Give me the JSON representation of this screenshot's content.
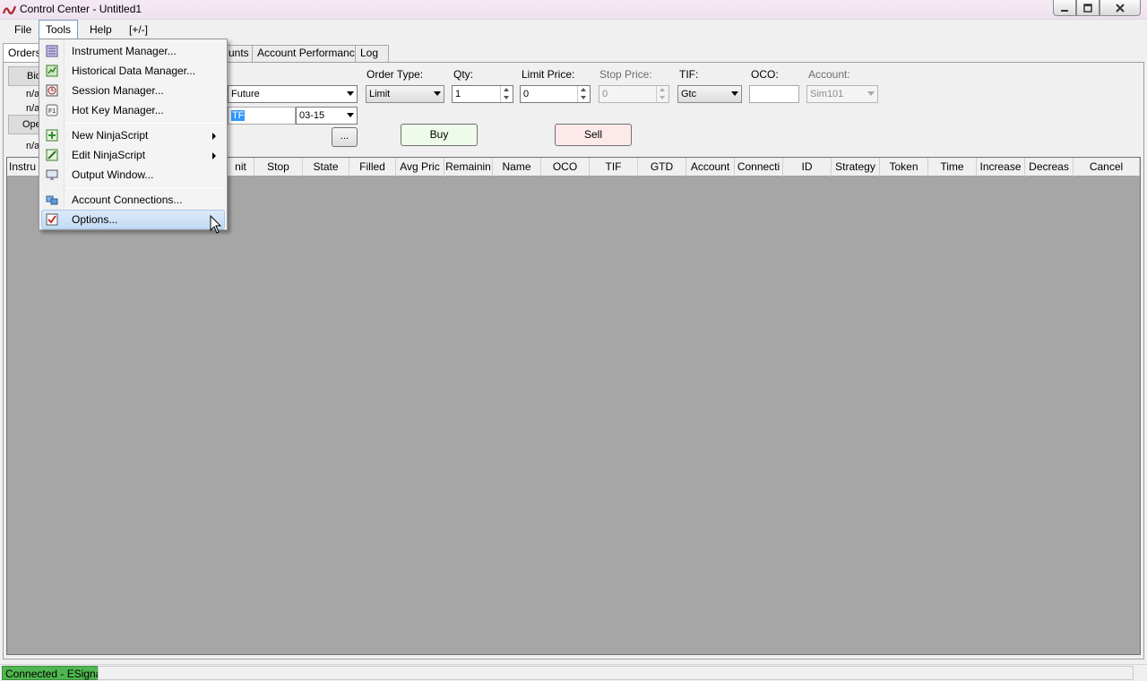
{
  "window": {
    "title": "Control Center - Untitled1",
    "app_icon": "ninjatrader-logo-icon"
  },
  "menubar": {
    "items": [
      {
        "label": "File"
      },
      {
        "label": "Tools"
      },
      {
        "label": "Help"
      },
      {
        "label": "[+/-]"
      }
    ]
  },
  "tabs": [
    {
      "label": "Orders"
    },
    {
      "label": "unts"
    },
    {
      "label": "Account Performance"
    },
    {
      "label": "Log"
    }
  ],
  "left_grid": {
    "rows": [
      {
        "label": "Bid"
      },
      {
        "label": "n/a"
      },
      {
        "label": "n/a"
      },
      {
        "label": "Ope"
      },
      {
        "label": "n/a"
      }
    ]
  },
  "order_entry": {
    "instrument_type": "Future",
    "instrument_name_selected": "TF",
    "expiry": "03-15",
    "browse_label": "...",
    "order_type_label": "Order Type:",
    "order_type_value": "Limit",
    "qty_label": "Qty:",
    "qty_value": "1",
    "limit_price_label": "Limit Price:",
    "limit_price_value": "0",
    "stop_price_label": "Stop Price:",
    "stop_price_value": "0",
    "tif_label": "TIF:",
    "tif_value": "Gtc",
    "oco_label": "OCO:",
    "oco_value": "",
    "account_label": "Account:",
    "account_value": "Sim101",
    "buy_label": "Buy",
    "sell_label": "Sell"
  },
  "orders_grid": {
    "columns": [
      "Instru",
      "nit",
      "Stop",
      "State",
      "Filled",
      "Avg Pric",
      "Remainin",
      "Name",
      "OCO",
      "TIF",
      "GTD",
      "Account",
      "Connecti",
      "ID",
      "Strategy",
      "Token",
      "Time",
      "Increase",
      "Decreas",
      "Cancel"
    ]
  },
  "tools_menu": {
    "items": [
      {
        "label": "Instrument Manager...",
        "icon": "instrument-manager-icon"
      },
      {
        "label": "Historical Data Manager...",
        "icon": "historical-data-icon"
      },
      {
        "label": "Session Manager...",
        "icon": "session-manager-icon"
      },
      {
        "label": "Hot Key Manager...",
        "icon": "hotkey-f1-icon"
      },
      {
        "label": "New NinjaScript",
        "icon": "new-script-icon"
      },
      {
        "label": "Edit NinjaScript",
        "icon": "edit-script-icon"
      },
      {
        "label": "Output Window...",
        "icon": "output-window-icon"
      },
      {
        "label": "Account Connections...",
        "icon": "account-connections-icon"
      },
      {
        "label": "Options...",
        "icon": "options-icon"
      }
    ]
  },
  "statusbar": {
    "connection": "Connected - ESignal"
  },
  "colors": {
    "connected_green": "#4fb74f",
    "buy_bg": "#eefbea",
    "sell_bg": "#fde9ea",
    "grid_bg": "#a6a6a6",
    "menu_highlight": "#c1dbf5"
  }
}
